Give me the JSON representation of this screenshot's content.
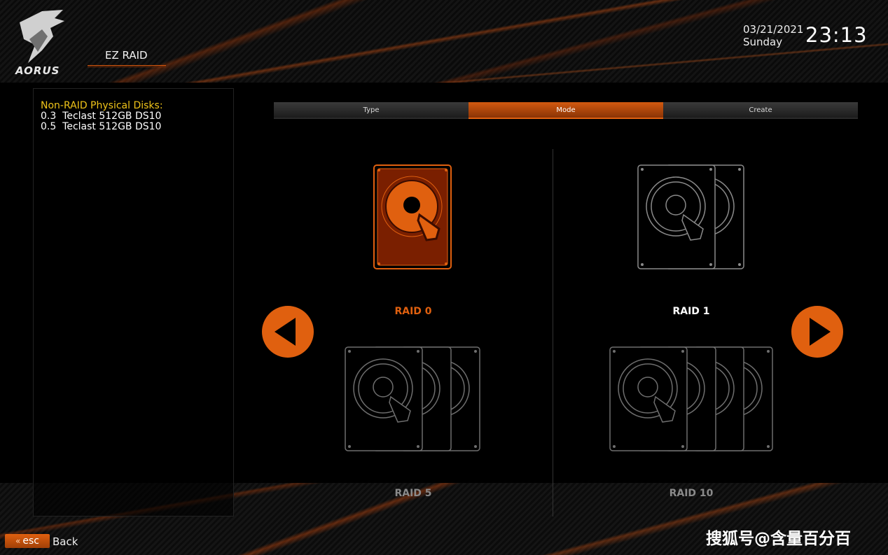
{
  "header": {
    "brand": "AORUS",
    "title": "EZ RAID",
    "date": "03/21/2021",
    "weekday": "Sunday",
    "time": "23:13"
  },
  "left_panel": {
    "heading": "Non-RAID Physical Disks:",
    "disks": [
      "0.3  Teclast 512GB DS10",
      "0.5  Teclast 512GB DS10"
    ]
  },
  "steps": [
    {
      "label": "Type",
      "active": false
    },
    {
      "label": "Mode",
      "active": true
    },
    {
      "label": "Create",
      "active": false
    }
  ],
  "raid_options": [
    {
      "label": "RAID 0",
      "disks": 1,
      "selected": true
    },
    {
      "label": "RAID 1",
      "disks": 2,
      "selected": false
    },
    {
      "label": "RAID 5",
      "disks": 3,
      "selected": false
    },
    {
      "label": "RAID 10",
      "disks": 4,
      "selected": false
    }
  ],
  "footer": {
    "esc_label": "esc",
    "back_label": "Back",
    "watermark": "搜狐号@含量百分百"
  },
  "colors": {
    "accent": "#e0600f",
    "heading_yellow": "#f0c419",
    "inactive_gray": "#8a8a8a"
  },
  "icons": {
    "prev": "triangle-left-icon",
    "next": "triangle-right-icon",
    "disk": "hard-drive-icon"
  }
}
